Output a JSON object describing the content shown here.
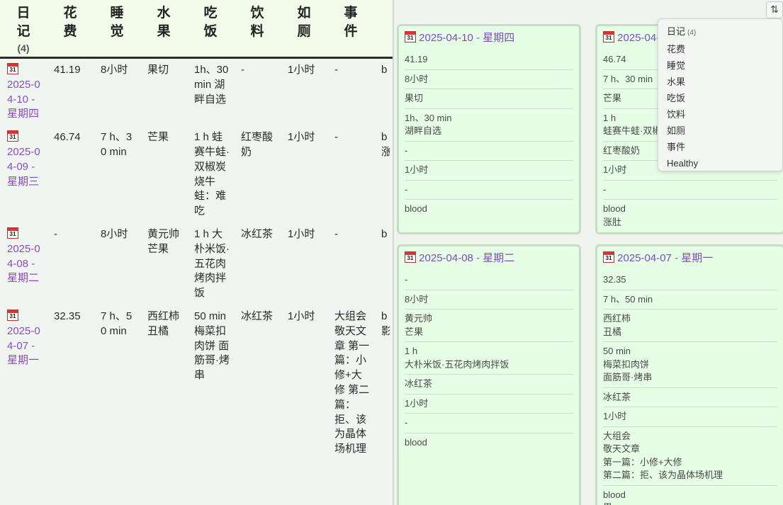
{
  "table": {
    "headers": [
      {
        "label": "日记",
        "count": "(4)"
      },
      {
        "label": "花费"
      },
      {
        "label": "睡觉"
      },
      {
        "label": "水果"
      },
      {
        "label": "吃饭"
      },
      {
        "label": "饮料"
      },
      {
        "label": "如厕"
      },
      {
        "label": "事件"
      }
    ],
    "rows": [
      {
        "date": "2025-04-10 - 星期四",
        "cost": "41.19",
        "sleep": "8小时",
        "fruit": "果切",
        "meal": "1h、30 min 湖畔自选",
        "drink": "-",
        "toilet": "1小时",
        "event": "-",
        "healthy": "b"
      },
      {
        "date": "2025-04-09 - 星期三",
        "cost": "46.74",
        "sleep": "7 h、30 min",
        "fruit": "芒果",
        "meal": "1 h 蛙赛牛蛙·双椒炭烧牛蛙：难吃",
        "drink": "红枣酸奶",
        "toilet": "1小时",
        "event": "-",
        "healthy": "b 涨"
      },
      {
        "date": "2025-04-08 - 星期二",
        "cost": "-",
        "sleep": "8小时",
        "fruit": "黄元帅 芒果",
        "meal": "1 h 大朴米饭·五花肉烤肉拌饭",
        "drink": "冰红茶",
        "toilet": "1小时",
        "event": "-",
        "healthy": "b"
      },
      {
        "date": "2025-04-07 - 星期一",
        "cost": "32.35",
        "sleep": "7 h、50 min",
        "fruit": "西红柿 丑橘",
        "meal": "50 min 梅菜扣肉饼 面筋哥·烤串",
        "drink": "冰红茶",
        "toilet": "1小时",
        "event": "大组会 敬天文章 第一篇：小修+大修 第二篇：拒、该为晶体场机理",
        "healthy": "b 影"
      }
    ]
  },
  "cards": [
    {
      "title": "2025-04-10 - 星期四",
      "cost": "41.19",
      "sleep": "8小时",
      "fruit": "果切",
      "meal_time": "1h、30 min",
      "meal_place": "湖畔自选",
      "drink": "-",
      "toilet": "1小时",
      "event": "-",
      "healthy": "blood",
      "healthy_note": ""
    },
    {
      "title": "2025-04-09 - 星期三",
      "cost": "46.74",
      "sleep": "7 h、30 min",
      "fruit": "芒果",
      "meal_time": "1 h",
      "meal_place": "蛙赛牛蛙·双椒炭烧牛蛙：难吃",
      "drink": "红枣酸奶",
      "toilet": "1小时",
      "event": "-",
      "healthy": "blood",
      "healthy_note": "涨肚"
    },
    {
      "title": "2025-04-08 - 星期二",
      "cost": "-",
      "sleep": "8小时",
      "fruit": "黄元帅",
      "fruit2": "芒果",
      "meal_time": "1 h",
      "meal_place": "大朴米饭·五花肉烤肉拌饭",
      "drink": "冰红茶",
      "toilet": "1小时",
      "event": "-",
      "healthy": "blood"
    },
    {
      "title": "2025-04-07 - 星期一",
      "cost": "32.35",
      "sleep": "7 h、50 min",
      "fruit": "西红柿",
      "fruit2": "丑橘",
      "meal_time": "50 min",
      "meal_place": "梅菜扣肉饼",
      "meal_place2": "面筋哥·烤串",
      "drink": "冰红茶",
      "toilet": "1小时",
      "event1": "大组会",
      "event2": "敬天文章",
      "event3": "第一篇：小修+大修",
      "event4": "第二篇：拒、该为晶体场机理",
      "healthy": "blood",
      "healthy_note": "果"
    }
  ],
  "sort_menu": {
    "items": [
      {
        "label": "日记",
        "count": "(4)"
      },
      {
        "label": "花费"
      },
      {
        "label": "睡觉"
      },
      {
        "label": "水果"
      },
      {
        "label": "吃饭"
      },
      {
        "label": "饮料"
      },
      {
        "label": "如厕"
      },
      {
        "label": "事件"
      },
      {
        "label": "Healthy"
      }
    ]
  },
  "icons": {
    "calendar_day": "31",
    "sort": "⇅"
  },
  "colors": {
    "card_bg": "#e6fde6",
    "card_border": "#c6dec6",
    "link": "#7b4dc2",
    "header_bg": "#f2fbea"
  }
}
